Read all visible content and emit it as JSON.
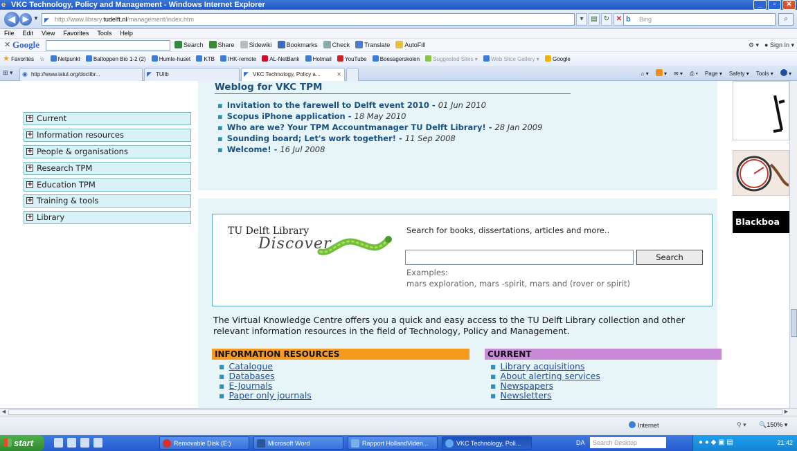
{
  "window": {
    "title": "VKC Technology, Policy and Management - Windows Internet Explorer"
  },
  "address": {
    "url_prefix": "http://www.library.",
    "url_host": "tudelft.nl",
    "url_suffix": "/management/index.htm",
    "search_placeholder": "Bing"
  },
  "menu": {
    "items": [
      "File",
      "Edit",
      "View",
      "Favorites",
      "Tools",
      "Help"
    ]
  },
  "google_bar": {
    "logo": "Google",
    "items": [
      "Search",
      "Share",
      "Sidewiki",
      "Bookmarks",
      "Check",
      "Translate",
      "AutoFill"
    ],
    "sign_in": "Sign In"
  },
  "favorites": {
    "label": "Favorites",
    "items": [
      "Netpunkt",
      "Baltoppen Bio 1-2 (2)",
      "Humle-huset",
      "KTB",
      "IHK-remote",
      "AL-NetBank",
      "Hotmail",
      "YouTube",
      "Boesagerskolen",
      "Suggested Sites",
      "Web Slice Gallery",
      "Google"
    ]
  },
  "tabs": [
    {
      "label": "http://www.iatul.org/doclibr..."
    },
    {
      "label": "TUlib"
    },
    {
      "label": "VKC Technology, Policy a..."
    }
  ],
  "command_bar": {
    "items": [
      "Page",
      "Safety",
      "Tools"
    ]
  },
  "nav": {
    "items": [
      "Current",
      "Information resources",
      "People & organisations",
      "Research TPM",
      "Education TPM",
      "Training & tools",
      "Library"
    ]
  },
  "weblog": {
    "title": "Weblog for VKC TPM",
    "posts": [
      {
        "title": "Invitation to the farewell to Delft event 2010",
        "date": "01 Jun 2010"
      },
      {
        "title": "Scopus iPhone application",
        "date": "18 May 2010"
      },
      {
        "title": "Who are we? Your TPM Accountmanager TU Delft Library!",
        "date": "28 Jan 2009"
      },
      {
        "title": "Sounding board; Let's work together!",
        "date": "11 Sep 2008"
      },
      {
        "title": "Welcome!",
        "date": "16 Jul 2008"
      }
    ]
  },
  "discover": {
    "logo_line1": "TU Delft Library",
    "logo_line2": "Discover",
    "intro": "Search for books, dissertations, articles and more..",
    "search_value": "",
    "button": "Search",
    "examples_label": "Examples:",
    "examples": "mars exploration, mars -spirit, mars and (rover or spirit)"
  },
  "intro_text": "The Virtual Knowledge Centre offers you a quick and easy access to the TU Delft Library collection and other relevant information resources in the field of Technology, Policy and Management.",
  "sections": {
    "information": {
      "title": "INFORMATION RESOURCES",
      "links": [
        "Catalogue",
        "Databases",
        "E-Journals",
        "Paper only journals"
      ]
    },
    "current": {
      "title": "CURRENT",
      "links": [
        "Library acquisitions",
        "About alerting services",
        "Newspapers",
        "Newsletters"
      ]
    }
  },
  "right_column": {
    "banner": "Blackboa"
  },
  "status": {
    "zone": "Internet",
    "zoom": "150%"
  },
  "taskbar": {
    "start": "start",
    "tasks": [
      "Removable Disk (E:)",
      "Microsoft Word",
      "Rapport HollandViden...",
      "VKC Technology, Poli..."
    ],
    "desktop_label": "DA",
    "desktop_search": "Search Desktop",
    "clock": "21:42"
  },
  "colors": {
    "nav_bg": "#d9f2f7",
    "panel_bg": "#e8f5f8",
    "info_head": "#f59a1e",
    "current_head": "#c98ad8",
    "link": "#1a4f9a"
  }
}
